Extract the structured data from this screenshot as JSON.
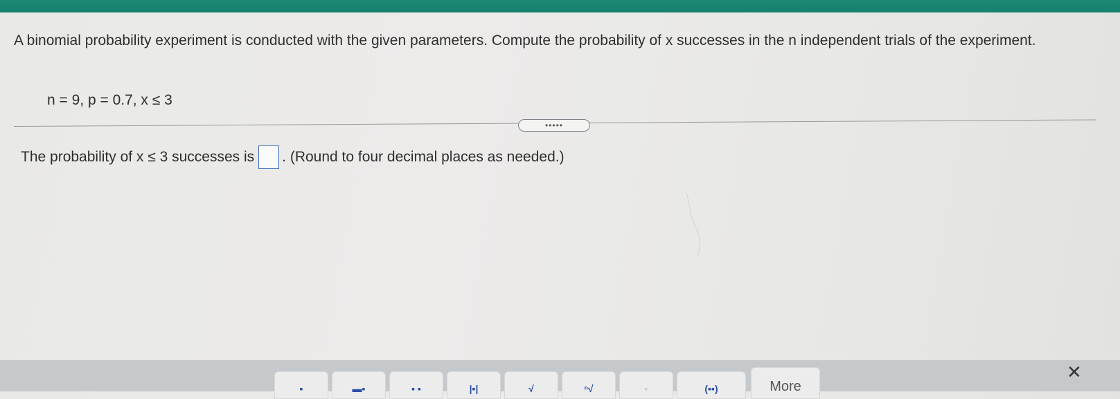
{
  "question": {
    "text": "A binomial probability experiment is conducted with the given parameters. Compute the probability of x successes in the n independent trials of the experiment.",
    "params": "n = 9, p = 0.7, x ≤ 3"
  },
  "expand": {
    "label": "•••••"
  },
  "answer": {
    "prefix": "The probability of x ≤ 3 successes is",
    "suffix": ". (Round to four decimal places as needed.)",
    "value": ""
  },
  "toolbar": {
    "buttons": [
      {
        "icon": "fraction-icon",
        "glyph": "▪"
      },
      {
        "icon": "mixed-number-icon",
        "glyph": "▬▪"
      },
      {
        "icon": "exponent-icon",
        "glyph": "▪ ▪"
      },
      {
        "icon": "absolute-value-icon",
        "glyph": "|▪|"
      },
      {
        "icon": "square-root-icon",
        "glyph": "√"
      },
      {
        "icon": "nth-root-icon",
        "glyph": "ⁿ√"
      },
      {
        "icon": "decimal-icon",
        "glyph": "▪"
      },
      {
        "icon": "parentheses-icon",
        "glyph": "(▪▪)"
      }
    ],
    "more_label": "More",
    "close_glyph": "✕"
  }
}
